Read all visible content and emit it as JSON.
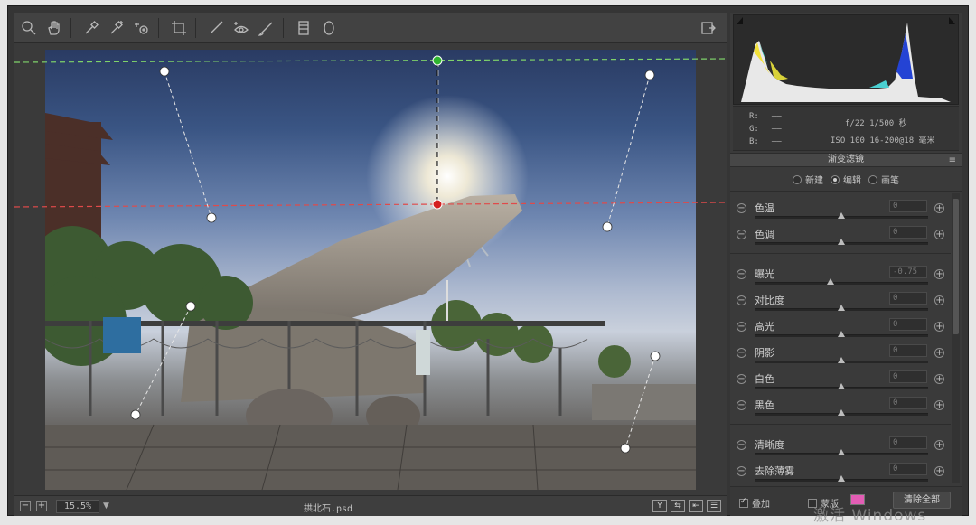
{
  "app": {
    "colors": {
      "frame": "#353535",
      "panel": "#3a3a3a",
      "accent": "#e35db5"
    }
  },
  "toolbar": {
    "tools": [
      {
        "name": "zoom-icon"
      },
      {
        "name": "hand-icon"
      },
      {
        "name": "white-balance-eyedropper-icon"
      },
      {
        "name": "color-sampler-icon"
      },
      {
        "name": "targeted-adjustment-icon"
      },
      {
        "name": "crop-icon"
      },
      {
        "name": "spot-removal-icon"
      },
      {
        "name": "red-eye-icon"
      },
      {
        "name": "adjustment-brush-icon"
      },
      {
        "name": "graduated-filter-icon"
      },
      {
        "name": "radial-filter-icon"
      }
    ],
    "fullscreen_icon": "fullscreen-toggle-icon"
  },
  "status": {
    "zoom": "15.5%",
    "filename": "拱北石.psd",
    "view_buttons": [
      "Y",
      "⇆",
      "⇤",
      "☰"
    ]
  },
  "info": {
    "rgb": [
      {
        "label": "R:",
        "value": "——"
      },
      {
        "label": "G:",
        "value": "——"
      },
      {
        "label": "B:",
        "value": "——"
      }
    ],
    "camera_line1": "f/22  1/500 秒",
    "camera_line2": "ISO 100  16-200@18 毫米"
  },
  "panel": {
    "title": "渐变滤镜",
    "modes": [
      {
        "label": "新建",
        "selected": false
      },
      {
        "label": "编辑",
        "selected": true
      },
      {
        "label": "画笔",
        "selected": false
      }
    ],
    "sliders": [
      {
        "label": "色温",
        "value": "0",
        "position": 0.5
      },
      {
        "label": "色调",
        "value": "0",
        "position": 0.5
      },
      {
        "label": "曝光",
        "value": "-0.75",
        "position": 0.44
      },
      {
        "label": "对比度",
        "value": "0",
        "position": 0.5
      },
      {
        "label": "高光",
        "value": "0",
        "position": 0.5
      },
      {
        "label": "阴影",
        "value": "0",
        "position": 0.5
      },
      {
        "label": "白色",
        "value": "0",
        "position": 0.5
      },
      {
        "label": "黑色",
        "value": "0",
        "position": 0.5
      },
      {
        "label": "清晰度",
        "value": "0",
        "position": 0.5
      },
      {
        "label": "去除薄雾",
        "value": "0",
        "position": 0.5
      }
    ],
    "overlay_label": "叠加",
    "overlay_checked": true,
    "mask_label": "蒙版",
    "mask_checked": false,
    "mask_color": "#e35db5",
    "clear_all": "清除全部"
  },
  "watermark": "激活 Windows"
}
